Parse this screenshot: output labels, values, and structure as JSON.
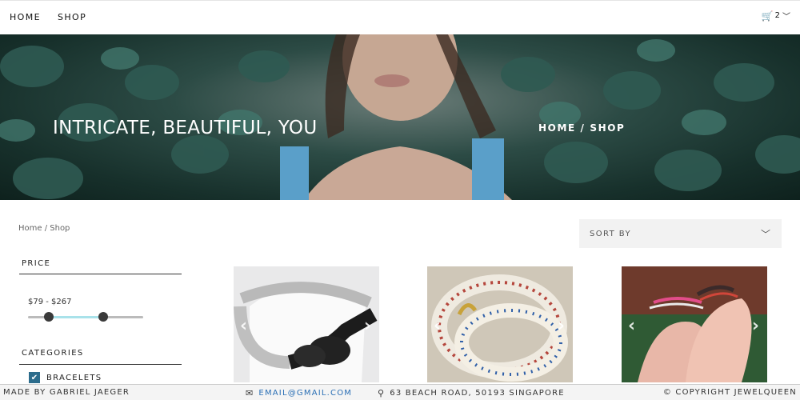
{
  "nav": {
    "links": [
      {
        "label": "HOME"
      },
      {
        "label": "SHOP"
      }
    ],
    "cart_count": "2",
    "cart_icon": "shopping-cart-icon"
  },
  "hero": {
    "tagline": "INTRICATE, BEAUTIFUL, YOU",
    "breadcrumb": "HOME / SHOP"
  },
  "breadcrumb": "Home / Shop",
  "sort": {
    "label": "SORT BY"
  },
  "filters": {
    "price": {
      "title": "PRICE",
      "range_text": "$79 - $267",
      "slider_low_fraction": 0.18,
      "slider_high_fraction": 0.65
    },
    "categories": {
      "title": "CATEGORIES",
      "items": [
        {
          "label": "BRACELETS",
          "checked": true
        }
      ]
    }
  },
  "products": [
    {
      "name": "black-white-beaded-necklace"
    },
    {
      "name": "multicolor-beaded-bracelet"
    },
    {
      "name": "friendship-bracelets-hands"
    }
  ],
  "footer": {
    "made_by": "MADE BY GABRIEL JAEGER",
    "email": "EMAIL@GMAIL.COM",
    "address": "63 BEACH ROAD, 50193 SINGAPORE",
    "copyright": "© COPYRIGHT JEWELQUEEN"
  },
  "colors": {
    "accent": "#2c6c8c",
    "link": "#2a6fb5",
    "slider_fill": "#a9e2ea"
  }
}
